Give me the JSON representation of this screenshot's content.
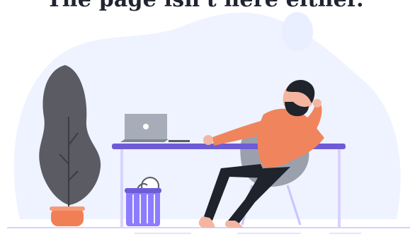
{
  "page": {
    "top_text": "The page isn't here either."
  },
  "illustration": {
    "icons": [
      "plant-icon",
      "laptop-icon",
      "trash-basket-icon",
      "person-icon",
      "chair-icon"
    ],
    "colors": {
      "bg_blob": "#eef3ff",
      "desk_top": "#6e5bd7",
      "desk_leg": "#d9d2ff",
      "plant": "#5a5b63",
      "pot": "#f07f55",
      "shirt": "#f0855d",
      "pants": "#1f232b",
      "chair": "#9aa0ac",
      "laptop": "#a7adb8",
      "basket": "#8d7cff",
      "floor": "#d9d2ff"
    }
  }
}
